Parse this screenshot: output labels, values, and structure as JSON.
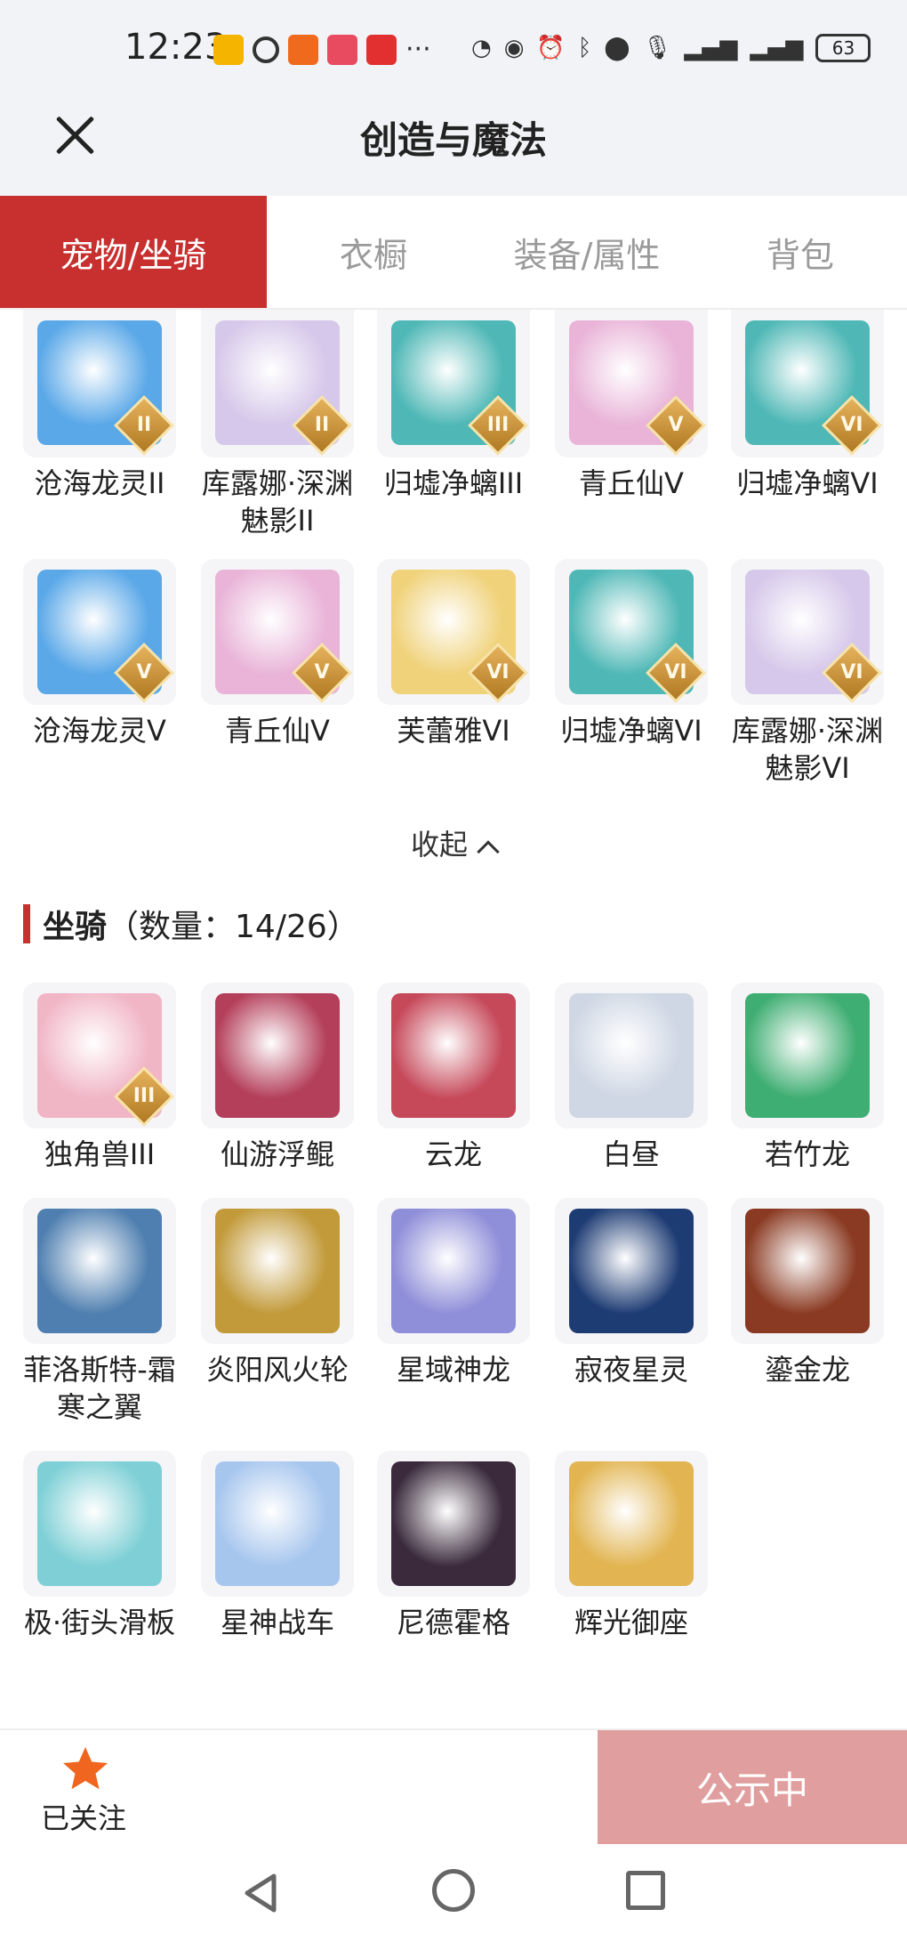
{
  "status": {
    "time": "12:23",
    "battery": "63"
  },
  "header": {
    "title": "创造与魔法"
  },
  "tabs": [
    {
      "label": "宠物/坐骑",
      "active": true
    },
    {
      "label": "衣橱",
      "active": false
    },
    {
      "label": "装备/属性",
      "active": false
    },
    {
      "label": "背包",
      "active": false
    }
  ],
  "pets": [
    {
      "name": "沧海龙灵II",
      "rank": "II",
      "color": "#5aa8e8"
    },
    {
      "name": "库露娜·深渊魅影II",
      "rank": "II",
      "color": "#d6c8ea"
    },
    {
      "name": "归墟净螭III",
      "rank": "III",
      "color": "#4fb8b6"
    },
    {
      "name": "青丘仙V",
      "rank": "V",
      "color": "#e9b4d8"
    },
    {
      "name": "归墟净螭VI",
      "rank": "VI",
      "color": "#4fb8b6"
    },
    {
      "name": "沧海龙灵V",
      "rank": "V",
      "color": "#5aa8e8"
    },
    {
      "name": "青丘仙V",
      "rank": "V",
      "color": "#e9b4d8"
    },
    {
      "name": "芙蕾雅VI",
      "rank": "VI",
      "color": "#f0d27a"
    },
    {
      "name": "归墟净螭VI",
      "rank": "VI",
      "color": "#4fb8b6"
    },
    {
      "name": "库露娜·深渊魅影VI",
      "rank": "VI",
      "color": "#d6c8ea"
    }
  ],
  "collapse": {
    "label": "收起"
  },
  "mounts_section": {
    "title": "坐骑",
    "count": "（数量：14/26）"
  },
  "mounts": [
    {
      "name": "独角兽III",
      "rank": "III",
      "color": "#f1b6c6"
    },
    {
      "name": "仙游浮鲲",
      "rank": "",
      "color": "#b43f5a"
    },
    {
      "name": "云龙",
      "rank": "",
      "color": "#c6495a"
    },
    {
      "name": "白昼",
      "rank": "",
      "color": "#cfd7e4"
    },
    {
      "name": "若竹龙",
      "rank": "",
      "color": "#3fae72"
    },
    {
      "name": "菲洛斯特-霜寒之翼",
      "rank": "",
      "color": "#4f7fb0"
    },
    {
      "name": "炎阳风火轮",
      "rank": "",
      "color": "#c29a3a"
    },
    {
      "name": "星域神龙",
      "rank": "",
      "color": "#8f8ed9"
    },
    {
      "name": "寂夜星灵",
      "rank": "",
      "color": "#1e3c74"
    },
    {
      "name": "鎏金龙",
      "rank": "",
      "color": "#8a3a22"
    },
    {
      "name": "极·街头滑板",
      "rank": "",
      "color": "#7fd0d6"
    },
    {
      "name": "星神战车",
      "rank": "",
      "color": "#a7c6ee"
    },
    {
      "name": "尼德霍格",
      "rank": "",
      "color": "#3a2a3c"
    },
    {
      "name": "辉光御座",
      "rank": "",
      "color": "#e2b552"
    }
  ],
  "bottom": {
    "follow_label": "已关注",
    "announce_label": "公示中"
  }
}
